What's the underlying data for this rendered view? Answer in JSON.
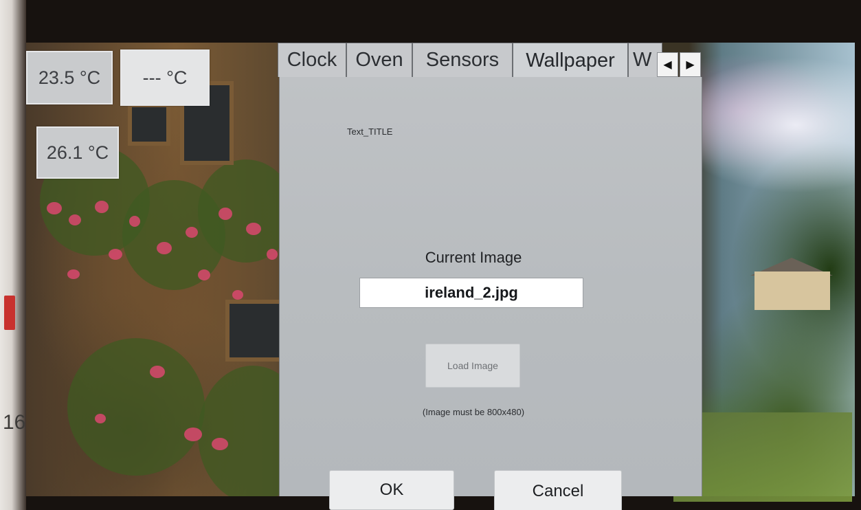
{
  "temperatures": {
    "sensor_1": "23.5 °C",
    "sensor_2": "--- °C",
    "sensor_3": "26.1 °C"
  },
  "tabs": [
    {
      "label": "Clock"
    },
    {
      "label": "Oven"
    },
    {
      "label": "Sensors"
    },
    {
      "label": "Wallpaper",
      "active": true
    },
    {
      "label": "W"
    }
  ],
  "tab_arrows": {
    "left_icon": "triangle-left-icon",
    "right_icon": "triangle-right-icon"
  },
  "wallpaper_panel": {
    "title_text": "Text_TITLE",
    "current_image_label": "Current Image",
    "current_image_value": "ireland_2.jpg",
    "load_button_label": "Load Image",
    "hint": "(Image must be 800x480)",
    "ok_label": "OK",
    "cancel_label": "Cancel"
  },
  "bezel": {
    "edge_text": "16"
  }
}
